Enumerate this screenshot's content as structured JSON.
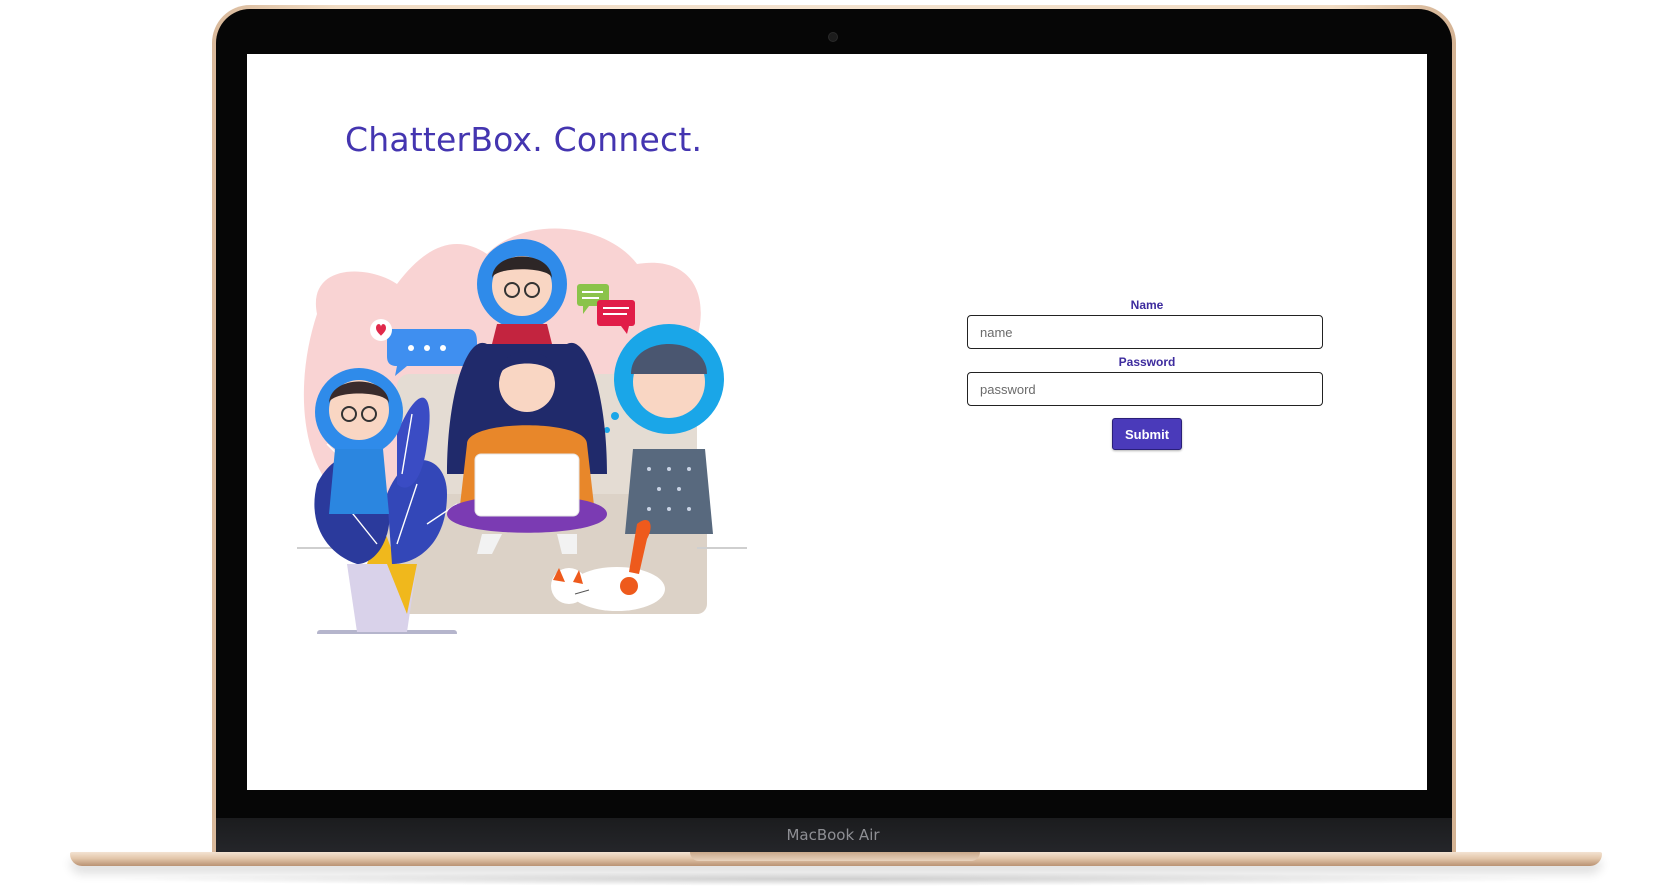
{
  "device": {
    "brand_label": "MacBook Air"
  },
  "header": {
    "title": "ChatterBox. Connect."
  },
  "illustration": {
    "icon": "people-chatting-illustration"
  },
  "login_form": {
    "name_label": "Name",
    "name_placeholder": "name",
    "password_label": "Password",
    "password_placeholder": "password",
    "submit_label": "Submit"
  },
  "colors": {
    "accent": "#4a3aba",
    "title": "#4435b0",
    "label": "#3d2b9e"
  }
}
